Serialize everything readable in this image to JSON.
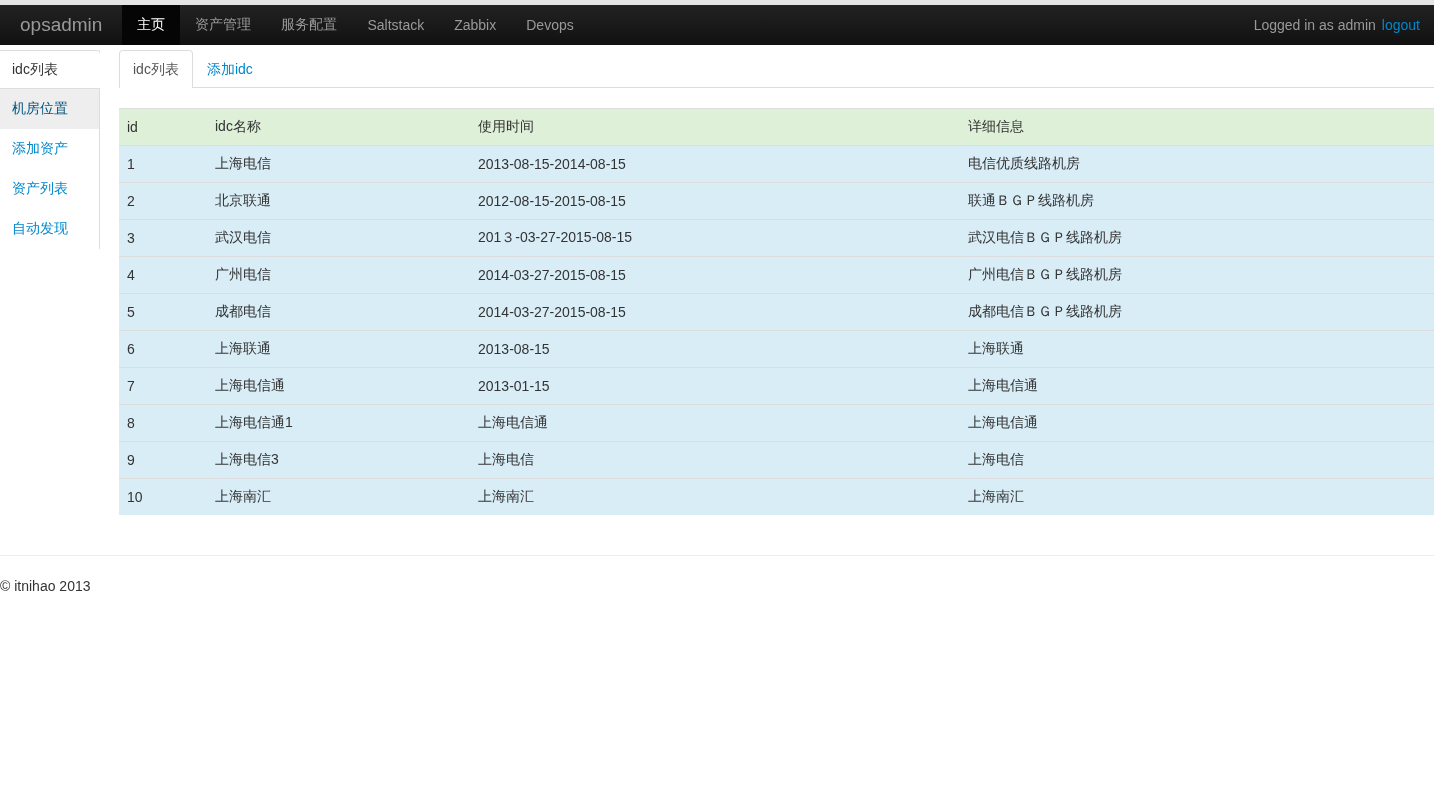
{
  "navbar": {
    "brand": "opsadmin",
    "items": [
      {
        "label": "主页",
        "selected": true
      },
      {
        "label": "资产管理",
        "selected": false
      },
      {
        "label": "服务配置",
        "selected": false
      },
      {
        "label": "Saltstack",
        "selected": false
      },
      {
        "label": "Zabbix",
        "selected": false
      },
      {
        "label": "Devops",
        "selected": false
      }
    ],
    "login_text": "Logged in as admin",
    "logout": "logout"
  },
  "sidebar": {
    "header": "idc列表",
    "items": [
      {
        "label": "机房位置",
        "selected": true
      },
      {
        "label": "添加资产",
        "selected": false
      },
      {
        "label": "资产列表",
        "selected": false
      },
      {
        "label": "自动发现",
        "selected": false
      }
    ]
  },
  "tabs": [
    {
      "label": "idc列表",
      "selected": true
    },
    {
      "label": "添加idc",
      "selected": false
    }
  ],
  "table": {
    "columns": [
      "id",
      "idc名称",
      "使用时间",
      "详细信息"
    ],
    "rows": [
      [
        "1",
        "上海电信",
        "2013-08-15-2014-08-15",
        "电信优质线路机房"
      ],
      [
        "2",
        "北京联通",
        "2012-08-15-2015-08-15",
        "联通ＢＧＰ线路机房"
      ],
      [
        "3",
        "武汉电信",
        "201３-03-27-2015-08-15",
        "武汉电信ＢＧＰ线路机房"
      ],
      [
        "4",
        "广州电信",
        "2014-03-27-2015-08-15",
        "广州电信ＢＧＰ线路机房"
      ],
      [
        "5",
        "成都电信",
        "2014-03-27-2015-08-15",
        "成都电信ＢＧＰ线路机房"
      ],
      [
        "6",
        "上海联通",
        "2013-08-15",
        "上海联通"
      ],
      [
        "7",
        "上海电信通",
        "2013-01-15",
        "上海电信通"
      ],
      [
        "8",
        "上海电信通1",
        "上海电信通",
        "上海电信通"
      ],
      [
        "9",
        "上海电信3",
        "上海电信",
        "上海电信"
      ],
      [
        "10",
        "上海南汇",
        "上海南汇",
        "上海南汇"
      ]
    ]
  },
  "footer": "© itnihao 2013"
}
